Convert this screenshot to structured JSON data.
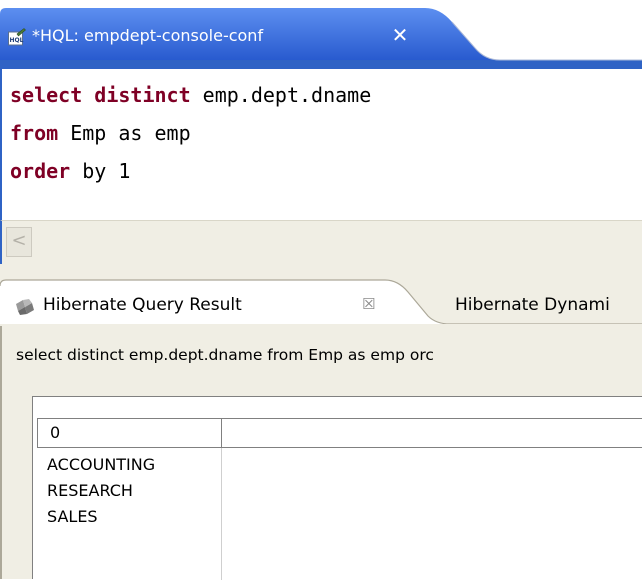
{
  "editor": {
    "tab_title": "*HQL: empdept-console-conf",
    "close_symbol": "✕",
    "code_lines": [
      {
        "keyword": "select distinct",
        "rest": " emp.dept.dname"
      },
      {
        "keyword": "from",
        "rest": " Emp as emp"
      },
      {
        "keyword": "order",
        "rest": " by 1"
      }
    ],
    "scroll_left_symbol": "<"
  },
  "result_view": {
    "tab_title": "Hibernate Query Result",
    "close_symbol": "☒",
    "other_tab_title": "Hibernate Dynami",
    "query_text": "select distinct emp.dept.dname from Emp as emp  orc",
    "table": {
      "columns": [
        "0"
      ],
      "rows": [
        "ACCOUNTING",
        "RESEARCH",
        "SALES"
      ]
    }
  },
  "colors": {
    "active_tab": "#2a5bd7",
    "keyword": "#7f0025",
    "panel_bg": "#f0eee4"
  }
}
